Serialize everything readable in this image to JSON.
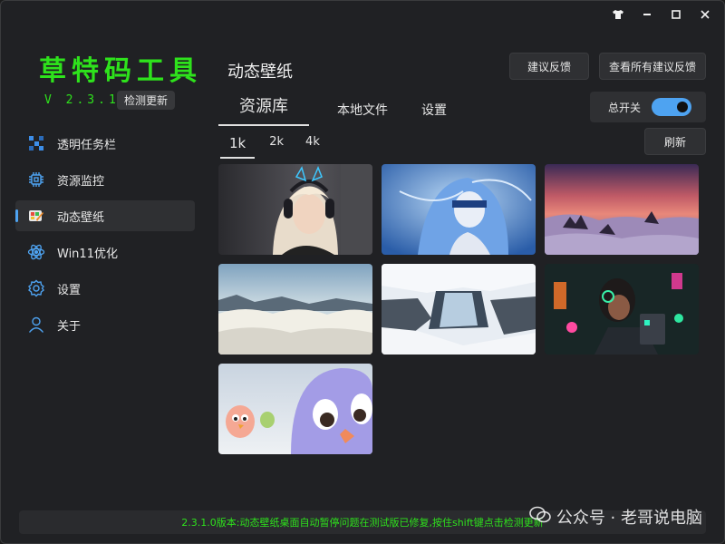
{
  "app": {
    "brand": "草特码工具",
    "version": "V 2.3.1.2",
    "check_update": "检测更新"
  },
  "window_controls": {
    "skin_icon": "tshirt-icon",
    "minimize_icon": "minimize-icon",
    "maximize_icon": "maximize-icon",
    "close_icon": "close-icon"
  },
  "sidebar": {
    "items": [
      {
        "label": "透明任务栏",
        "icon": "taskbar-icon"
      },
      {
        "label": "资源监控",
        "icon": "chip-icon"
      },
      {
        "label": "动态壁纸",
        "icon": "palette-icon"
      },
      {
        "label": "Win11优化",
        "icon": "atom-icon"
      },
      {
        "label": "设置",
        "icon": "gear-icon"
      },
      {
        "label": "关于",
        "icon": "user-icon"
      }
    ],
    "active_index": 2
  },
  "page": {
    "title": "动态壁纸",
    "feedback_btn": "建议反馈",
    "view_feedback_btn": "查看所有建议反馈",
    "tabs": [
      "资源库",
      "本地文件",
      "设置"
    ],
    "active_tab": 0,
    "master_switch_label": "总开关",
    "master_switch_on": true,
    "refresh_btn": "刷新",
    "resolutions": [
      "1k",
      "2k",
      "4k"
    ],
    "active_resolution": 0
  },
  "wallpapers": [
    {
      "name": "anime-girl-headphones"
    },
    {
      "name": "blue-hair-girl-blindfold"
    },
    {
      "name": "sunset-above-clouds"
    },
    {
      "name": "sea-of-clouds"
    },
    {
      "name": "snowy-waterfall"
    },
    {
      "name": "cyberpunk-character"
    },
    {
      "name": "angry-birds-chicks"
    }
  ],
  "status": {
    "message": "2.3.1.0版本:动态壁纸桌面自动暂停问题在测试版已修复,按住shift键点击检测更新"
  },
  "watermark": {
    "text": "公众号 · 老哥说电脑"
  },
  "colors": {
    "accent_green": "#2ee21c",
    "accent_blue": "#4ea3f1",
    "background": "#202124"
  }
}
